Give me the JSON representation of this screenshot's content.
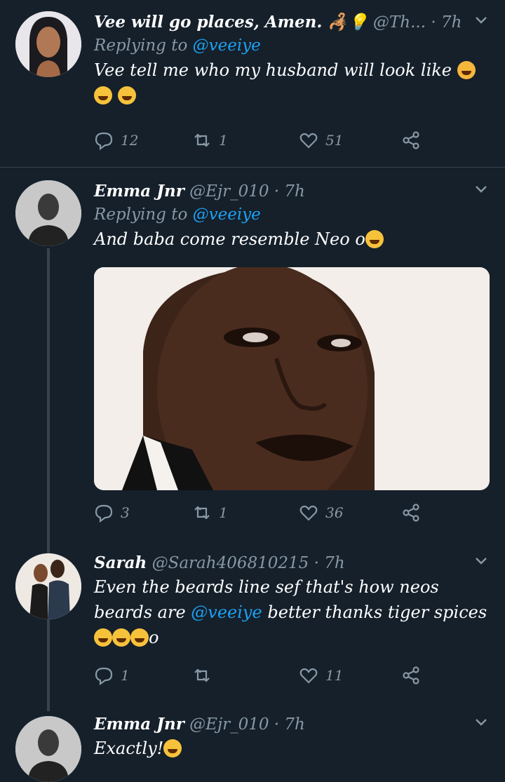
{
  "tweets": [
    {
      "name": "Vee will go places, Amen. 🦂💡",
      "handle": "@Th...",
      "time": "· 7h",
      "replying_label": "Replying to",
      "replying_to": "@veeiye",
      "text": "Vee tell me who my husband will look like",
      "counts": {
        "replies": "12",
        "retweets": "1",
        "likes": "51"
      }
    },
    {
      "name": "Emma Jnr",
      "handle": "@Ejr_010",
      "time": "· 7h",
      "replying_label": "Replying to",
      "replying_to": "@veeiye",
      "text": "And baba come resemble Neo o",
      "counts": {
        "replies": "3",
        "retweets": "1",
        "likes": "36"
      }
    },
    {
      "name": "Sarah",
      "handle": "@Sarah406810215",
      "time": "· 7h",
      "text_before": "Even the beards line sef that's how neos beards are",
      "mention": "@veeiye",
      "text_after": "better thanks tiger spices",
      "text_tail": "o",
      "counts": {
        "replies": "1",
        "retweets": "",
        "likes": "11"
      }
    },
    {
      "name": "Emma Jnr",
      "handle": "@Ejr_010",
      "time": "· 7h",
      "text": "Exactly!"
    }
  ],
  "colors": {
    "background": "#15202b",
    "muted": "#8899a6",
    "link": "#1da1f2",
    "divider": "#38444d"
  },
  "icons": [
    "reply-icon",
    "retweet-icon",
    "like-icon",
    "share-icon",
    "chevron-down-icon"
  ]
}
